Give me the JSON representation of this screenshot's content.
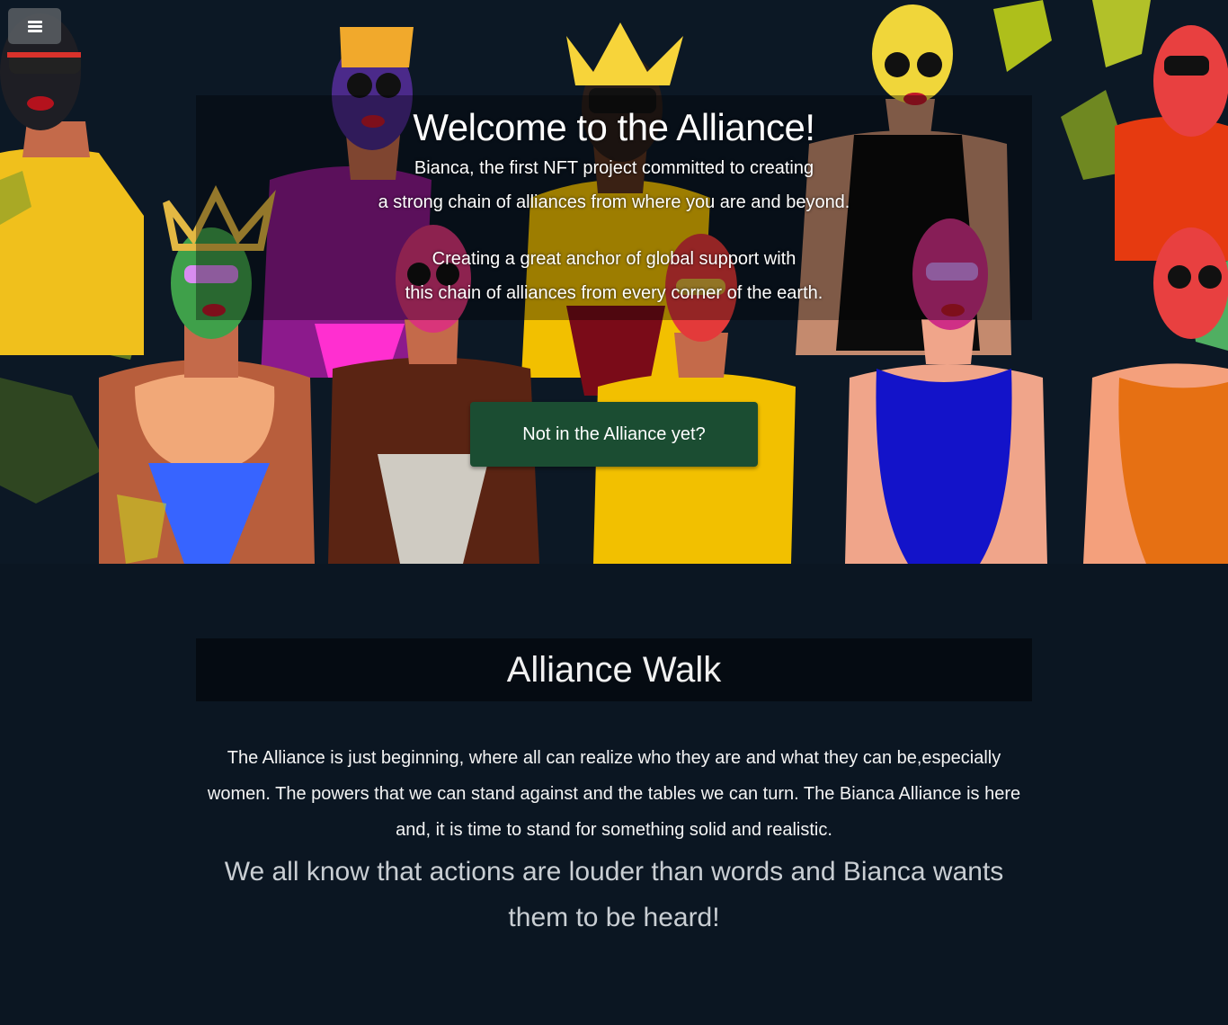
{
  "nav": {
    "menu_icon": "hamburger-icon"
  },
  "hero": {
    "title": "Welcome to the Alliance!",
    "lines": [
      "Bianca, the first NFT project committed to creating",
      "a strong chain of alliances from where you are and beyond.",
      "Creating a great anchor of global support with",
      "this chain of alliances from every corner of the earth."
    ],
    "cta_label": "Not in the Alliance yet?"
  },
  "walk": {
    "heading": "Alliance Walk",
    "body": "The Alliance is just beginning, where all can realize who they are and what they can be,especially women. The powers that we can stand against and the tables we can turn. The Bianca Alliance is here and, it is time to stand for something solid and realistic.",
    "quote": "We all know that actions are louder than words and Bianca wants them to be heard!"
  },
  "colors": {
    "page_background": "#0b1622",
    "cta_background": "#1b4d32",
    "heading_panel": "#050b12"
  }
}
